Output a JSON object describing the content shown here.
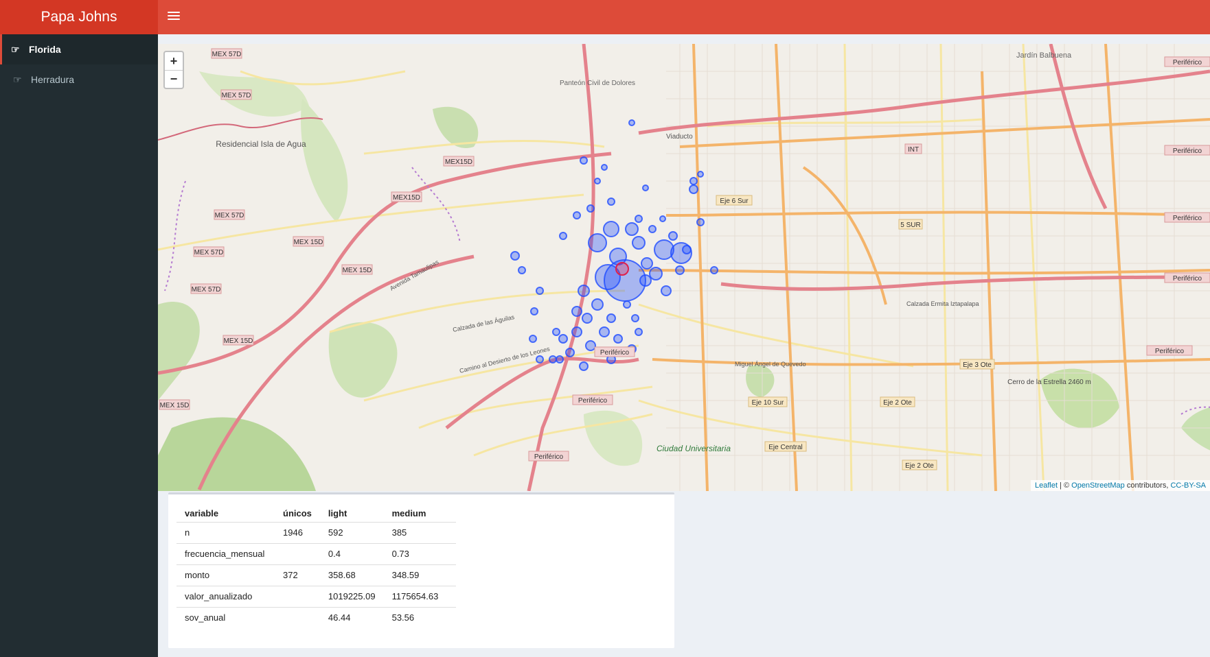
{
  "app": {
    "title": "Papa Johns"
  },
  "sidebar": {
    "items": [
      {
        "label": "Florida",
        "icon": "hand-point-right-icon",
        "active": true
      },
      {
        "label": "Herradura",
        "icon": "hand-point-right-icon",
        "active": false
      }
    ]
  },
  "map": {
    "zoom_in": "+",
    "zoom_out": "−",
    "attribution": {
      "leaflet": "Leaflet",
      "sep": " | © ",
      "osm": "OpenStreetMap",
      "mid": " contributors, ",
      "license": "CC-BY-SA"
    },
    "labels": [
      "MEX 57D",
      "MEX 57D",
      "MEX 57D",
      "MEX 57D",
      "MEX 57D",
      "MEX 15D",
      "MEX15D",
      "MEX15D",
      "MEX 15D",
      "MEX 15D",
      "MEX 15D",
      "Residencial Isla de Agua",
      "Panteón Civil de Dolores",
      "Periférico",
      "Periférico",
      "Periférico",
      "Eje 6 Sur",
      "Eje 10 Sur",
      "Eje Central",
      "Eje 2 Ote",
      "Eje 2 Ote",
      "Eje 3 Ote",
      "5 SUR",
      "Cerro de la Estrella 2460 m",
      "Ciudad Universitaria",
      "Viaducto",
      "Jardín Balbuena",
      "Calzada Ermita Iztapalapa",
      "Miguel Ángel de Quevedo",
      "Avenida Tamaulipas",
      "Calzada de las Águilas",
      "Camino al Desierto de los Leones",
      "INT",
      "Periférico",
      "Periférico",
      "Periférico",
      "Periférico",
      "Periférico"
    ]
  },
  "table": {
    "headers": [
      "variable",
      "únicos",
      "light",
      "medium"
    ],
    "rows": [
      [
        "n",
        "1946",
        "592",
        "385"
      ],
      [
        "frecuencia_mensual",
        "",
        "0.4",
        "0.73"
      ],
      [
        "monto",
        "372",
        "358.68",
        "348.59"
      ],
      [
        "valor_anualizado",
        "",
        "1019225.09",
        "1175654.63"
      ],
      [
        "sov_anual",
        "",
        "46.44",
        "53.56"
      ]
    ]
  },
  "colors": {
    "header": "#dd4b39",
    "logo": "#d33724",
    "sidebar": "#222d32",
    "marker": "#1f4cff",
    "marker_highlight": "#e0204a"
  }
}
